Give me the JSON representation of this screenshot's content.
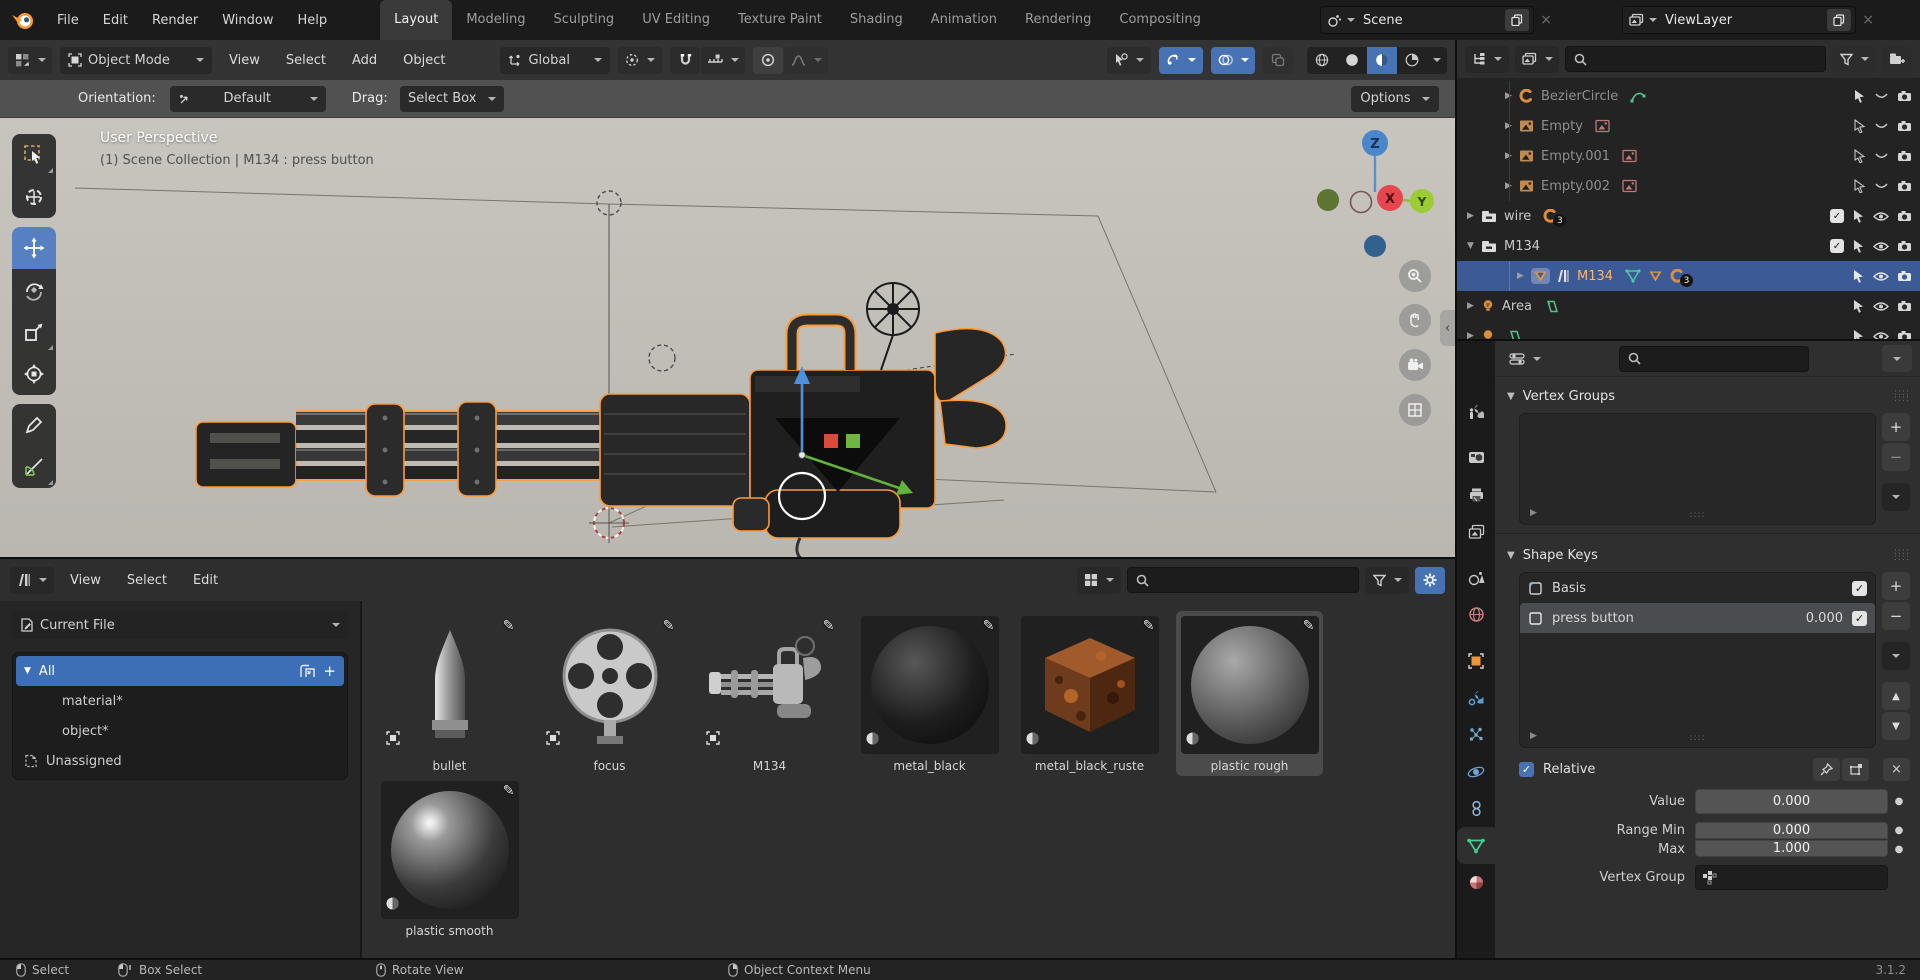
{
  "topbar": {
    "menus": [
      "File",
      "Edit",
      "Render",
      "Window",
      "Help"
    ],
    "workspaces": [
      "Layout",
      "Modeling",
      "Sculpting",
      "UV Editing",
      "Texture Paint",
      "Shading",
      "Animation",
      "Rendering",
      "Compositing"
    ],
    "scene_name": "Scene",
    "view_layer_name": "ViewLayer"
  },
  "viewport_header": {
    "mode": "Object Mode",
    "menu_view": "View",
    "menu_select": "Select",
    "menu_add": "Add",
    "menu_object": "Object",
    "orientation": "Global"
  },
  "tool_settings": {
    "orientation_label": "Orientation:",
    "orientation_value": "Default",
    "drag_label": "Drag:",
    "drag_value": "Select Box",
    "options_label": "Options"
  },
  "viewport": {
    "overlay_title": "User Perspective",
    "overlay_context": "(1) Scene Collection | M134 : press button",
    "axis_z": "Z",
    "axis_x": "X",
    "axis_y": "Y"
  },
  "outliner": {
    "rows": [
      {
        "name": "BezierCircle"
      },
      {
        "name": "Empty"
      },
      {
        "name": "Empty.001"
      },
      {
        "name": "Empty.002"
      },
      {
        "name": "wire",
        "badge": "3"
      },
      {
        "name": "M134"
      },
      {
        "name": "M134",
        "badge": "3"
      },
      {
        "name": "Area"
      }
    ]
  },
  "properties": {
    "vertex_groups_title": "Vertex Groups",
    "shape_keys_title": "Shape Keys",
    "shape_keys": [
      {
        "name": "Basis"
      },
      {
        "name": "press button",
        "value": "0.000"
      }
    ],
    "relative_label": "Relative",
    "value_label": "Value",
    "value": "0.000",
    "range_min_label": "Range Min",
    "range_min": "0.000",
    "max_label": "Max",
    "max": "1.000",
    "vertex_group_label": "Vertex Group"
  },
  "asset_browser": {
    "menu_view": "View",
    "menu_select": "Select",
    "menu_edit": "Edit",
    "source": "Current File",
    "catalogs": [
      {
        "name": "All"
      },
      {
        "name": "material*"
      },
      {
        "name": "object*"
      },
      {
        "name": "Unassigned"
      }
    ],
    "assets": [
      {
        "name": "bullet",
        "kind": "object"
      },
      {
        "name": "focus",
        "kind": "object"
      },
      {
        "name": "M134",
        "kind": "object"
      },
      {
        "name": "metal_black",
        "kind": "material"
      },
      {
        "name": "metal_black_ruste",
        "kind": "material"
      },
      {
        "name": "plastic rough",
        "kind": "material"
      },
      {
        "name": "plastic smooth",
        "kind": "material"
      }
    ]
  },
  "status_bar": {
    "select": "Select",
    "box_select": "Box Select",
    "rotate_view": "Rotate View",
    "context_menu": "Object Context Menu",
    "version": "3.1.2"
  },
  "colors": {
    "accent_blue": "#4772b3",
    "selection_outline_orange": "#ff9a33",
    "selected_row_blue": "#3b5a96",
    "active_tool_blue": "#5680c2"
  }
}
